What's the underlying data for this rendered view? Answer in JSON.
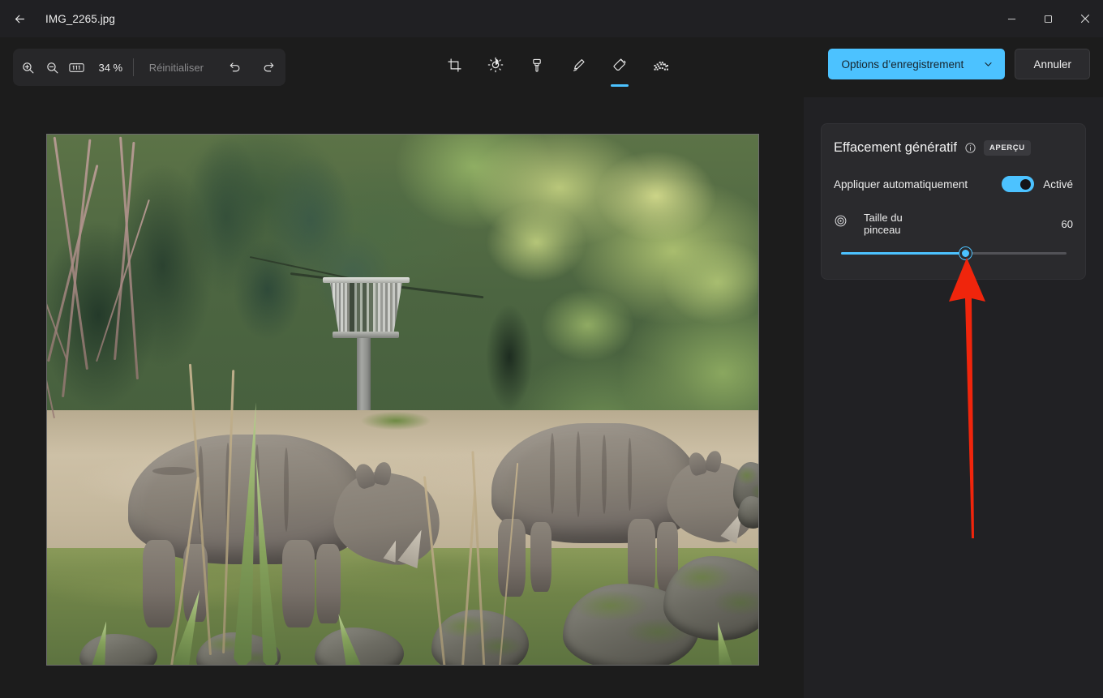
{
  "window": {
    "file_name": "IMG_2265.jpg",
    "back_icon": "arrow-left-icon",
    "minimize_label": "─",
    "maximize_label": "❐",
    "close_label": "✕"
  },
  "toolbar": {
    "zoom_in_icon": "zoom-in-icon",
    "zoom_out_icon": "zoom-out-icon",
    "actual_size_icon": "actual-size-1-1-icon",
    "zoom_level": "34 %",
    "reset_label": "Réinitialiser",
    "undo_icon": "undo-icon",
    "redo_icon": "redo-icon",
    "tools": [
      {
        "name": "crop",
        "icon": "crop-icon",
        "selected": false
      },
      {
        "name": "adjust",
        "icon": "brightness-icon",
        "selected": false
      },
      {
        "name": "markup-brush",
        "icon": "paintbrush-icon",
        "selected": false
      },
      {
        "name": "pen",
        "icon": "pen-icon",
        "selected": false
      },
      {
        "name": "erase",
        "icon": "eraser-icon",
        "selected": true
      },
      {
        "name": "blur",
        "icon": "blur-mosaic-icon",
        "selected": false
      }
    ],
    "save_label": "Options d’enregistrement",
    "save_chevron_icon": "chevron-down-icon",
    "cancel_label": "Annuler"
  },
  "panel": {
    "title": "Effacement génératif",
    "info_icon": "info-circle-icon",
    "preview_badge": "APERÇU",
    "auto_apply_label": "Appliquer automatiquement",
    "auto_apply_state": "Activé",
    "auto_apply_on": true,
    "brush_icon": "brush-size-target-icon",
    "brush_label": "Taille du pinceau",
    "brush_value": "60",
    "brush_percent": 55
  },
  "annotation": {
    "arrow_icon": "red-arrow-up-icon",
    "color": "#f0250c"
  },
  "colors": {
    "accent": "#4cc2ff",
    "window_bg": "#1c1c1c",
    "titlebar_bg": "#202023",
    "panel_bg": "#2a2a2d",
    "sidebar_bg": "#212124"
  },
  "photo": {
    "alt": "Deux rhinocéros dans un enclos de zoo",
    "zoom": "34 %"
  }
}
